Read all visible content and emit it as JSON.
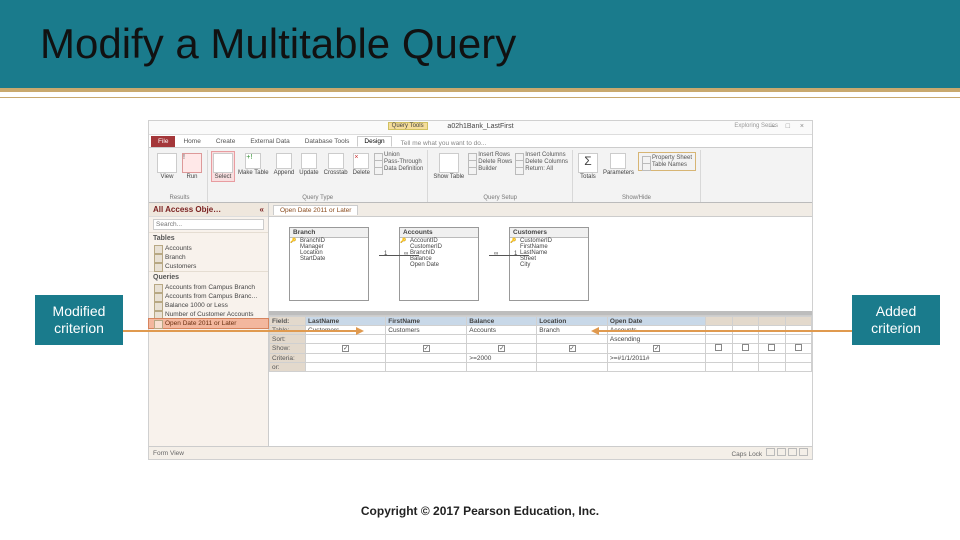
{
  "slide": {
    "title": "Modify a Multitable Query",
    "callout_left": "Modified criterion",
    "callout_right": "Added criterion",
    "copyright": "Copyright © 2017 Pearson Education, Inc."
  },
  "window": {
    "title_center": "a02h1Bank_LastFirst",
    "query_tools_tab": "Query Tools",
    "hint": "Exploring Series",
    "ctrls": "— □ ×"
  },
  "tabs": [
    "File",
    "Home",
    "Create",
    "External Data",
    "Database Tools",
    "Design"
  ],
  "active_tab": "Design",
  "tell_me": "Tell me what you want to do...",
  "ribbon": {
    "results": {
      "view": "View",
      "run": "Run",
      "label": "Results"
    },
    "qtype": {
      "select": "Select",
      "make": "Make Table",
      "append": "Append",
      "update": "Update",
      "crosstab": "Crosstab",
      "delete": "Delete",
      "union": "Union",
      "pass": "Pass-Through",
      "datadef": "Data Definition",
      "label": "Query Type"
    },
    "qsetup": {
      "show": "Show Table",
      "insrow": "Insert Rows",
      "delrow": "Delete Rows",
      "builder": "Builder",
      "inscol": "Insert Columns",
      "delcol": "Delete Columns",
      "return": "Return:",
      "return_val": "All",
      "label": "Query Setup"
    },
    "showhide": {
      "totals": "Totals",
      "params": "Parameters",
      "prop": "Property Sheet",
      "tnames": "Table Names",
      "label": "Show/Hide"
    }
  },
  "navpane": {
    "header": "All Access Obje…",
    "search_placeholder": "Search...",
    "group_tables": "Tables",
    "tables": [
      "Accounts",
      "Branch",
      "Customers"
    ],
    "group_queries": "Queries",
    "queries": [
      "Accounts from Campus Branch",
      "Accounts from Campus Branc…",
      "Balance 1000 or Less",
      "Number of Customer Accounts",
      "Open Date 2011 or Later"
    ]
  },
  "query_tab_name": "Open Date 2011 or Later",
  "tableboxes": [
    {
      "name": "Branch",
      "fields": [
        "BranchID",
        "Manager",
        "Location",
        "StartDate"
      ]
    },
    {
      "name": "Accounts",
      "fields": [
        "AccountID",
        "CustomerID",
        "BranchID",
        "Balance",
        "Open Date"
      ]
    },
    {
      "name": "Customers",
      "fields": [
        "CustomerID",
        "FirstName",
        "LastName",
        "Street",
        "City"
      ]
    }
  ],
  "grid_rows": {
    "field_label": "Field:",
    "table_label": "Table:",
    "sort_label": "Sort:",
    "show_label": "Show:",
    "criteria_label": "Criteria:",
    "or_label": "or:"
  },
  "grid_cols": [
    {
      "field": "LastName",
      "table": "Customers",
      "sort": "",
      "show": true,
      "criteria": ""
    },
    {
      "field": "FirstName",
      "table": "Customers",
      "sort": "",
      "show": true,
      "criteria": ""
    },
    {
      "field": "Balance",
      "table": "Accounts",
      "sort": "",
      "show": true,
      "criteria": ">=2000"
    },
    {
      "field": "Location",
      "table": "Branch",
      "sort": "",
      "show": true,
      "criteria": ""
    },
    {
      "field": "Open Date",
      "table": "Accounts",
      "sort": "Ascending",
      "show": true,
      "criteria": ">=#1/1/2011#"
    },
    {
      "field": "",
      "table": "",
      "sort": "",
      "show": false,
      "criteria": ""
    },
    {
      "field": "",
      "table": "",
      "sort": "",
      "show": false,
      "criteria": ""
    },
    {
      "field": "",
      "table": "",
      "sort": "",
      "show": false,
      "criteria": ""
    },
    {
      "field": "",
      "table": "",
      "sort": "",
      "show": false,
      "criteria": ""
    }
  ],
  "statusbar": {
    "left": "Form View",
    "caps": "Caps Lock"
  }
}
